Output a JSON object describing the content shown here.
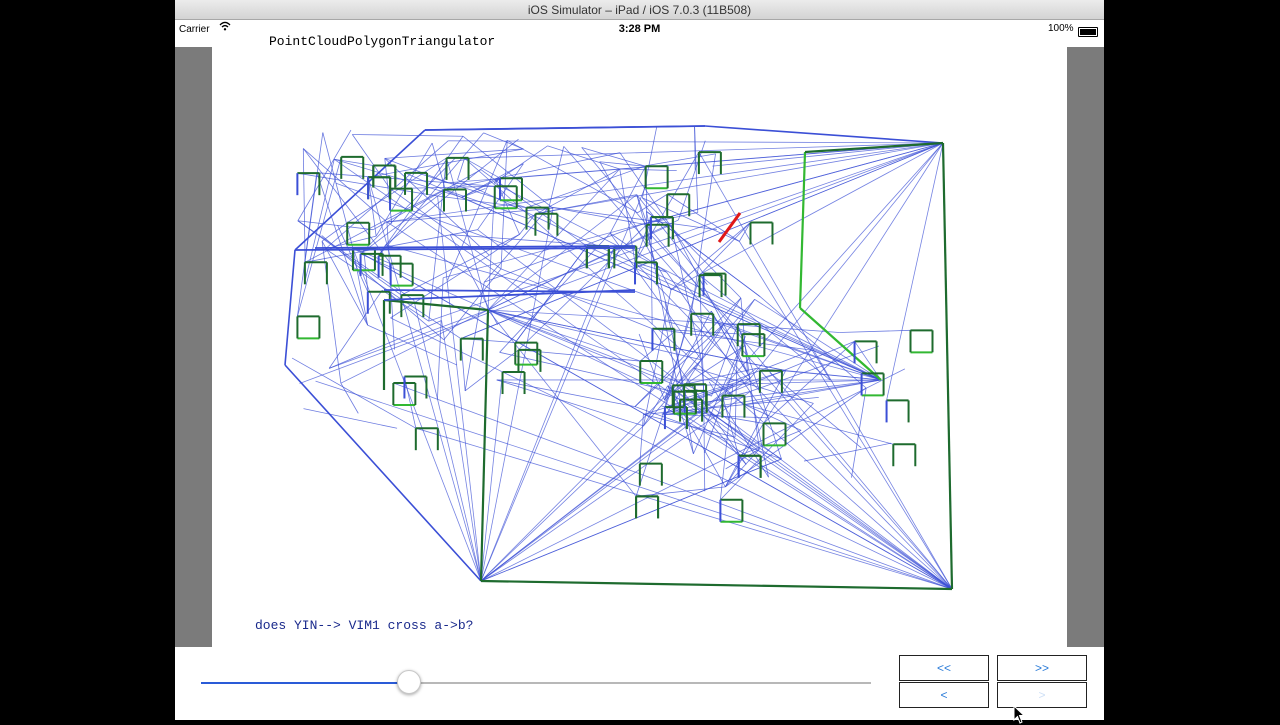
{
  "window": {
    "title": "iOS Simulator – iPad / iOS 7.0.3 (11B508)"
  },
  "statusbar": {
    "carrier": "Carrier",
    "wifi_icon": "wifi-icon",
    "time": "3:28 PM",
    "battery": "100%"
  },
  "app": {
    "title": "PointCloudPolygonTriangulator",
    "question": "does YIN--> VIM1  cross a->b?"
  },
  "colors": {
    "mesh": "#3b4fd6",
    "polygon_edge": "#1e6b2e",
    "constrained_edge": "#32b832",
    "highlight_edge": "#e01818",
    "ios_blue": "#2a7bd8"
  },
  "controls": {
    "slider_value": 0.31,
    "first_label": "<<",
    "last_label": ">>",
    "prev_label": "<",
    "next_label": ">"
  }
}
